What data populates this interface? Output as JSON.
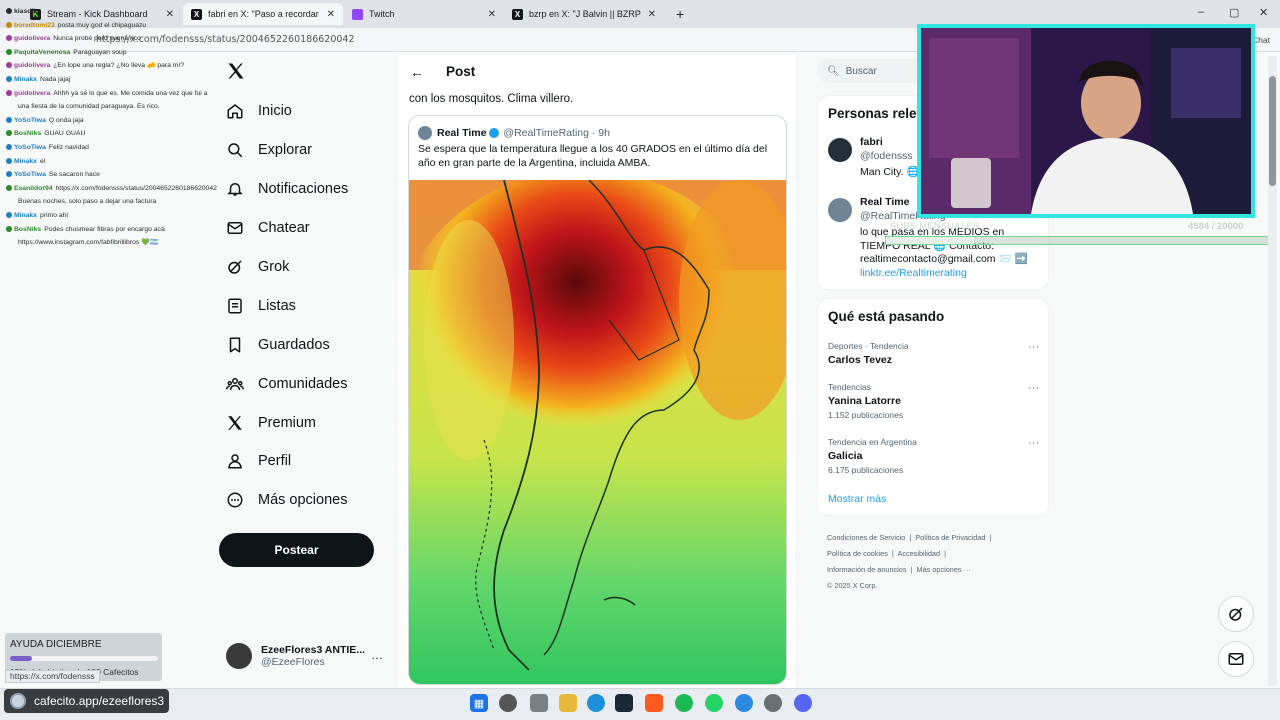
{
  "browser": {
    "tabs": [
      {
        "label": "Stream - Kick Dashboard",
        "fav": "K",
        "favcolor": "#1b1b1b"
      },
      {
        "label": "fabri en X: \"Paso a recordar que el",
        "fav": "X",
        "favcolor": "#0f1419"
      },
      {
        "label": "Twitch",
        "fav": "",
        "favcolor": "#9146ff"
      },
      {
        "label": "bzrp en X: \"J Balvin || BZRP Music",
        "fav": "X",
        "favcolor": "#0f1419"
      }
    ],
    "new_tab": "+",
    "url": "https://x.com/fodensss/status/2004652260186620042",
    "win_min": "–",
    "win_max": "▢",
    "win_close": "✕",
    "chat_btn": "Chat"
  },
  "chat": {
    "lines": [
      {
        "user": "kiasdik",
        "text": "",
        "color": "#2b2b2b"
      },
      {
        "user": "boredtomi23",
        "text": "posta muy god el chipaguazu",
        "color": "#c28a00"
      },
      {
        "user": "guidolivera",
        "text": "Nunca probé pero suena rico",
        "color": "#a03a9b"
      },
      {
        "user": "PaquitaVenenosa",
        "text": "Paraguayan soup",
        "color": "#2a8a2a"
      },
      {
        "user": "guidolivera",
        "text": "¿En lope una regla? ¿No lleva 🧀 para mí?",
        "color": "#a03a9b"
      },
      {
        "user": "Minakx",
        "text": "Nada jajaj",
        "color": "#1f7fc2"
      },
      {
        "user": "guidolivera",
        "text": "Ahhh ya sé lo que es. Me comida una vez que fui a",
        "color": "#a03a9b"
      },
      {
        "user": "",
        "text": "una fiesta de la comunidad paraguaya. Es rico.",
        "color": "#a03a9b"
      },
      {
        "user": "YoSoTiwa",
        "text": "Q onda jaja",
        "color": "#1f7fc2"
      },
      {
        "user": "BosNiks",
        "text": "GUAU GUAU",
        "color": "#2a8a2a"
      },
      {
        "user": "YoSoTiwa",
        "text": "Feliz navidad",
        "color": "#1f7fc2"
      },
      {
        "user": "Minakx",
        "text": "el",
        "color": "#1f7fc2"
      },
      {
        "user": "YoSoTiwa",
        "text": "Se sacaron hace",
        "color": "#1f7fc2"
      },
      {
        "user": "Esanildor94",
        "text": "https://x.com/fodensss/status/2004652260186620042",
        "color": "#2a8a2a"
      },
      {
        "user": "",
        "text": "Buenas noches, solo paso a dejar una factura",
        "color": "#2a8a2a"
      },
      {
        "user": "Minakx",
        "text": "primo ahi",
        "color": "#1f7fc2"
      },
      {
        "user": "BosNiks",
        "text": "Podes chusmear fibras por encargo acá",
        "color": "#2a8a2a"
      },
      {
        "user": "",
        "text": "https://www.instagram.com/fabfibrillibros 💚🇦🇷",
        "color": "#2a8a2a"
      }
    ]
  },
  "nav": {
    "items": [
      {
        "label": "Inicio",
        "icon": "home-icon"
      },
      {
        "label": "Explorar",
        "icon": "search-icon"
      },
      {
        "label": "Notificaciones",
        "icon": "bell-icon"
      },
      {
        "label": "Chatear",
        "icon": "mail-icon"
      },
      {
        "label": "Grok",
        "icon": "grok-icon"
      },
      {
        "label": "Listas",
        "icon": "list-icon"
      },
      {
        "label": "Guardados",
        "icon": "bookmark-icon"
      },
      {
        "label": "Comunidades",
        "icon": "communities-icon"
      },
      {
        "label": "Premium",
        "icon": "x-icon"
      },
      {
        "label": "Perfil",
        "icon": "person-icon"
      },
      {
        "label": "Más opciones",
        "icon": "more-icon"
      }
    ],
    "post_button": "Postear",
    "account_name": "EzeeFlores3 ANTIE...",
    "account_handle": "@EzeeFlores",
    "account_more": "…"
  },
  "main": {
    "back": "←",
    "title": "Post",
    "tweet_tail": "con los mosquitos. Clima villero.",
    "quote": {
      "name": "Real Time",
      "handle_time": "@RealTimeRating · 9h",
      "text": "Se espera que la temperatura llegue a los 40 GRADOS en el último día del año en gran parte de la Argentina, incluida AMBA."
    }
  },
  "right": {
    "search_placeholder": "Buscar",
    "people": {
      "title": "Personas relevantes",
      "items": [
        {
          "name": "fabri",
          "handle": "@fodensss",
          "bio": "Man City. 🌐"
        },
        {
          "name": "Real Time",
          "handle": "@RealTimeRating",
          "bio": "lo que pasa en los MEDIOS en TIEMPO REAL 🌐 Contacto: realtimecontacto@gmail.com 📨 ➡️",
          "link": "linktr.ee/Realtimerating"
        }
      ]
    },
    "trends": {
      "title": "Qué está pasando",
      "items": [
        {
          "context": "Deportes · Tendencia",
          "name": "Carlos Tevez",
          "posts": ""
        },
        {
          "context": "Tendencias",
          "name": "Yanina Latorre",
          "posts": "1.152 publicaciones"
        },
        {
          "context": "Tendencia en Argentina",
          "name": "Galicia",
          "posts": "6.175 publicaciones"
        }
      ],
      "show_more": "Mostrar más",
      "more": "···"
    },
    "footer": {
      "l1a": "Condiciones de Servicio",
      "l1b": "Política de Privacidad",
      "l2a": "Política de cookies",
      "l2b": "Accesibilidad",
      "l3a": "Información de anuncios",
      "l3b": "Más opciones ···",
      "l4": "© 2025 X Corp."
    }
  },
  "overlay": {
    "goal_label": "SUBS MENSUALES",
    "goal_value": "4584 / 20000",
    "goal_progress": 0.23,
    "ayuda_title": "AYUDA DICIEMBRE",
    "ayuda_sub": "15% del objetivo de 100 Cafecitos",
    "ayuda_progress": 0.15,
    "status_url": "https://x.com/fodensss",
    "cafecito": "cafecito.app/ezeeflores3"
  },
  "colors": {
    "accent": "#1d9bf0",
    "cam_border": "#31e6e0",
    "goal_border": "#74d88a"
  }
}
